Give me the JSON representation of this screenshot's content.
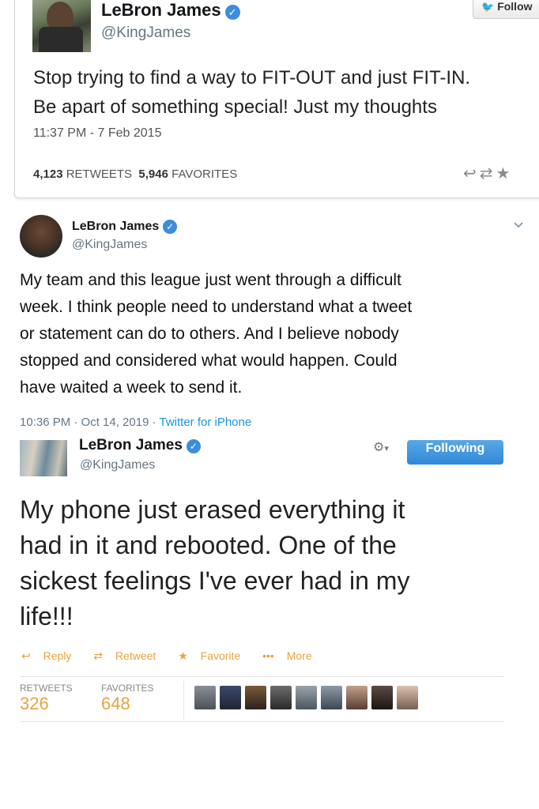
{
  "tweet1": {
    "name": "LeBron James",
    "handle": "@KingJames",
    "follow_label": "Follow",
    "text_line1": "Stop trying to find a way to FIT-OUT and just FIT-IN.",
    "text_line2": "Be apart of something special! Just my thoughts",
    "timestamp": "11:37 PM - 7 Feb 2015",
    "retweets_count": "4,123",
    "retweets_label": "RETWEETS",
    "favorites_count": "5,946",
    "favorites_label": "FAVORITES",
    "actions": [
      "reply-icon",
      "retweet-icon",
      "favorite-icon"
    ]
  },
  "tweet2": {
    "name": "LeBron James",
    "handle": "@KingJames",
    "text_lines": [
      "My team and this league just went through a difficult",
      "week.  I think people need to understand what a tweet",
      "or statement can do to others.  And I believe nobody",
      "stopped and considered what would happen.  Could",
      "have waited a week to send it."
    ],
    "timestamp": "10:36 PM · Oct 14, 2019 · ",
    "source": "Twitter for iPhone",
    "menu_icon": "chevron-down-icon"
  },
  "tweet3": {
    "name": "LeBron James",
    "handle": "@KingJames",
    "following_label": "Following",
    "text_lines": [
      "My phone just erased everything it",
      "had in it and rebooted. One of the",
      "sickest feelings I've ever had in my",
      "life!!!"
    ],
    "actions": {
      "reply": "Reply",
      "retweet": "Retweet",
      "favorite": "Favorite",
      "more": "More"
    },
    "retweets_label": "RETWEETS",
    "retweets_count": "326",
    "favorites_label": "FAVORITES",
    "favorites_count": "648",
    "accent_color": "#e8a33e"
  }
}
